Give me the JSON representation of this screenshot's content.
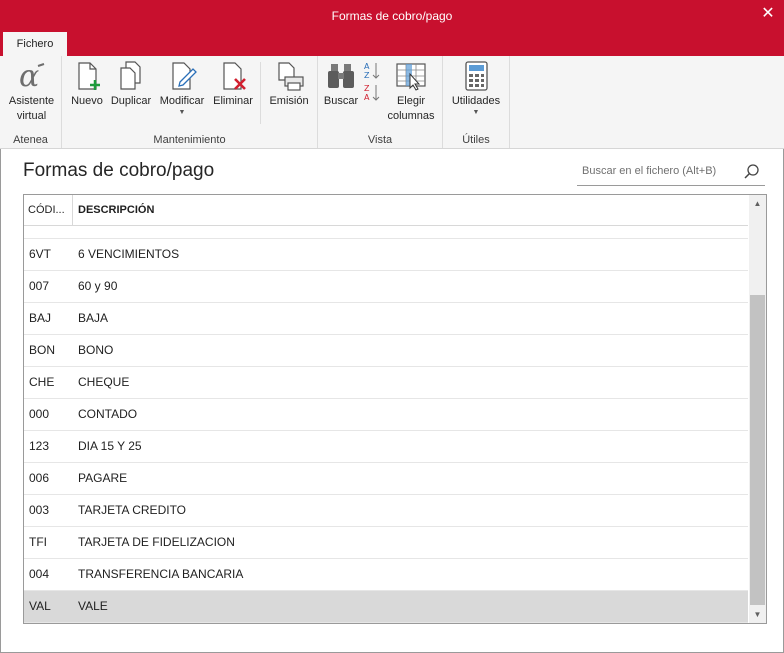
{
  "window": {
    "title": "Formas de cobro/pago",
    "close_glyph": "✕"
  },
  "ribbon": {
    "tab": "Fichero",
    "groups": {
      "atenea": "Atenea",
      "mantenimiento": "Mantenimiento",
      "vista": "Vista",
      "utiles": "Útiles"
    },
    "buttons": {
      "asistente_line1": "Asistente",
      "asistente_line2": "virtual",
      "nuevo": "Nuevo",
      "duplicar": "Duplicar",
      "modificar": "Modificar",
      "eliminar": "Eliminar",
      "emision": "Emisión",
      "buscar": "Buscar",
      "elegir_line1": "Elegir",
      "elegir_line2": "columnas",
      "utilidades": "Utilidades"
    }
  },
  "page": {
    "title": "Formas de cobro/pago",
    "search_placeholder": "Buscar en el fichero (Alt+B)"
  },
  "table": {
    "headers": {
      "code": "CÓDI...",
      "description": "DESCRIPCIÓN"
    },
    "rows": [
      {
        "code": "6VT",
        "description": "6 VENCIMIENTOS"
      },
      {
        "code": "007",
        "description": "60 y 90"
      },
      {
        "code": "BAJ",
        "description": "BAJA"
      },
      {
        "code": "BON",
        "description": "BONO"
      },
      {
        "code": "CHE",
        "description": "CHEQUE"
      },
      {
        "code": "000",
        "description": "CONTADO"
      },
      {
        "code": "123",
        "description": "DIA 15 Y 25"
      },
      {
        "code": "006",
        "description": "PAGARE"
      },
      {
        "code": "003",
        "description": "TARJETA CREDITO"
      },
      {
        "code": "TFI",
        "description": "TARJETA DE FIDELIZACION"
      },
      {
        "code": "004",
        "description": "TRANSFERENCIA BANCARIA"
      },
      {
        "code": "VAL",
        "description": "VALE"
      }
    ],
    "selected_code": "VAL"
  },
  "colors": {
    "accent": "#c8102e",
    "ribbon_bg": "#f5f5f5",
    "selected_row": "#d9d9d9"
  }
}
